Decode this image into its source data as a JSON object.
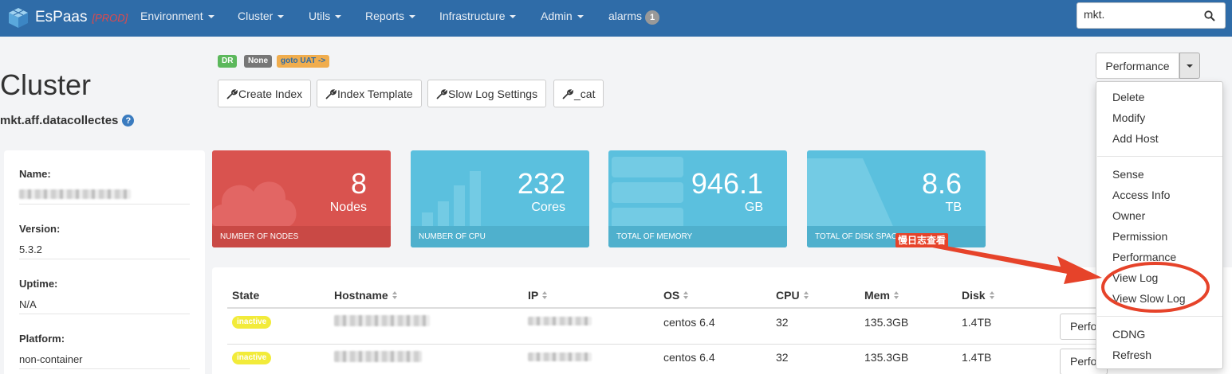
{
  "brand": {
    "name": "EsPaas",
    "env": "[PROD]"
  },
  "nav": {
    "items": [
      {
        "label": "Environment"
      },
      {
        "label": "Cluster"
      },
      {
        "label": "Utils"
      },
      {
        "label": "Reports"
      },
      {
        "label": "Infrastructure"
      },
      {
        "label": "Admin"
      }
    ],
    "alarms": {
      "label": "alarms",
      "count": "1"
    },
    "search_value": "mkt."
  },
  "page": {
    "title": "Cluster",
    "cluster_name": "mkt.aff.datacollectes",
    "help_glyph": "?"
  },
  "labels": [
    {
      "text": "DR",
      "color": "#5cb85c"
    },
    {
      "text": "None",
      "color": "#777777"
    },
    {
      "text": "goto UAT ->",
      "color": "#f0ad4e"
    }
  ],
  "toolbar": {
    "create_index": "Create Index",
    "index_template": "Index Template",
    "slow_log_settings": "Slow Log Settings",
    "cat": "_cat"
  },
  "performance_dropdown": {
    "label": "Performance",
    "items_group1": [
      "Delete",
      "Modify",
      "Add Host"
    ],
    "items_group2": [
      "Sense",
      "Access Info",
      "Owner",
      "Permission",
      "Performance",
      "View Log",
      "View Slow Log"
    ],
    "items_group3": [
      "CDNG",
      "Refresh"
    ]
  },
  "info": {
    "name_label": "Name:",
    "version_label": "Version:",
    "version": "5.3.2",
    "uptime_label": "Uptime:",
    "uptime": "N/A",
    "platform_label": "Platform:",
    "platform": "non-container"
  },
  "tiles": [
    {
      "value": "8",
      "unit": "Nodes",
      "footer": "NUMBER OF NODES",
      "color": "#d9534f"
    },
    {
      "value": "232",
      "unit": "Cores",
      "footer": "NUMBER OF CPU",
      "color": "#5bc0de"
    },
    {
      "value": "946.1",
      "unit": "GB",
      "footer": "TOTAL OF MEMORY",
      "color": "#5bc0de"
    },
    {
      "value": "8.6",
      "unit": "TB",
      "footer": "TOTAL OF DISK SPACE",
      "color": "#5bc0de"
    }
  ],
  "table": {
    "headers": [
      "State",
      "Hostname",
      "IP",
      "OS",
      "CPU",
      "Mem",
      "Disk"
    ],
    "rows": [
      {
        "state": "inactive",
        "os": "centos 6.4",
        "cpu": "32",
        "mem": "135.3GB",
        "disk": "1.4TB",
        "action": "Performance"
      },
      {
        "state": "inactive",
        "os": "centos 6.4",
        "cpu": "32",
        "mem": "135.3GB",
        "disk": "1.4TB",
        "action": "Performance"
      }
    ]
  },
  "annotation": {
    "text": "慢日志查看",
    "color": "#e6432a"
  }
}
